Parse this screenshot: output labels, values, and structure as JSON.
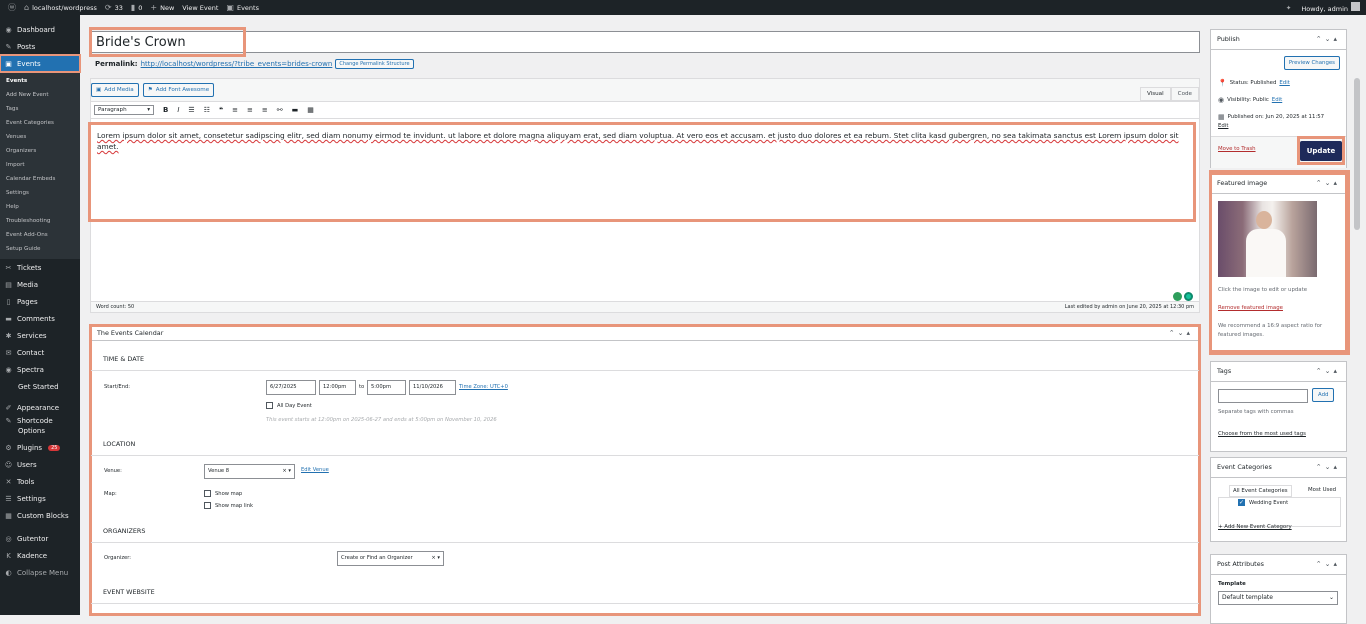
{
  "adminbar": {
    "site": "localhost/wordpress",
    "updates": "33",
    "comments": "0",
    "new": "New",
    "view_event": "View Event",
    "events": "Events",
    "howdy": "Howdy, admin"
  },
  "sidebar": {
    "items": [
      {
        "label": "Dashboard",
        "icon": "dashboard-icon"
      },
      {
        "label": "Posts",
        "icon": "pin-icon"
      },
      {
        "label": "Events",
        "icon": "calendar-icon"
      }
    ],
    "events_sub": [
      "Events",
      "Add New Event",
      "Tags",
      "Event Categories",
      "Venues",
      "Organizers",
      "Import",
      "Calendar Embeds",
      "Settings",
      "Help",
      "Troubleshooting",
      "Event Add-Ons",
      "Setup Guide"
    ],
    "items2": [
      {
        "label": "Tickets"
      },
      {
        "label": "Media"
      },
      {
        "label": "Pages"
      },
      {
        "label": "Comments"
      },
      {
        "label": "Services"
      },
      {
        "label": "Contact"
      },
      {
        "label": "Spectra"
      },
      {
        "label": "Get Started"
      },
      {
        "label": "Appearance"
      },
      {
        "label": "Shortcode"
      },
      {
        "label": "Options"
      },
      {
        "label": "Plugins",
        "badge": "25"
      },
      {
        "label": "Users"
      },
      {
        "label": "Tools"
      },
      {
        "label": "Settings"
      },
      {
        "label": "Custom Blocks"
      },
      {
        "label": "Gutentor"
      },
      {
        "label": "Kadence"
      },
      {
        "label": "Collapse Menu"
      }
    ]
  },
  "post": {
    "title": "Bride's Crown",
    "permalink_label": "Permalink:",
    "permalink": "http://localhost/wordpress/?tribe_events=brides-crown",
    "change_permalink": "Change Permalink Structure"
  },
  "editor": {
    "add_media": "Add Media",
    "add_fa": "Add Font Awesome",
    "tab_visual": "Visual",
    "tab_code": "Code",
    "format": "Paragraph",
    "content": "Lorem ipsum dolor sit amet, consetetur sadipscing elitr, sed diam nonumy eirmod te invidunt. ut labore et dolore magna aliquyam erat, sed diam voluptua. At vero eos et accusam. et justo duo dolores et ea rebum. Stet clita kasd gubergren, no sea takimata sanctus est Lorem ipsum dolor sit amet.",
    "word_count": "Word count: 50",
    "last_edited": "Last edited by admin on June 20, 2025 at 12:30 pm"
  },
  "tec": {
    "title": "The Events Calendar",
    "time_date": "TIME & DATE",
    "start_end": "Start/End:",
    "start_date": "6/27/2025",
    "start_time": "12:00pm",
    "to": "to",
    "end_time": "5:00pm",
    "end_date": "11/10/2026",
    "timezone": "Time Zone: UTC+0",
    "all_day": "All Day Event",
    "note": "This event starts at 12:00pm on 2025-06-27 and ends at 5:00pm on November 10, 2026",
    "location": "LOCATION",
    "venue_label": "Venue:",
    "venue": "Venue 8",
    "edit_venue": "Edit Venue",
    "map_label": "Map:",
    "show_map": "Show map",
    "show_map_link": "Show map link",
    "organizers": "ORGANIZERS",
    "organizer_label": "Organizer:",
    "organizer_ph": "Create or Find an Organizer",
    "website": "EVENT WEBSITE"
  },
  "publish": {
    "title": "Publish",
    "preview": "Preview Changes",
    "status": "Status: Published",
    "visibility": "Visibility: Public",
    "published_on": "Published on: Jun 20, 2025 at 11:57",
    "edit": "Edit",
    "trash": "Move to Trash",
    "update": "Update"
  },
  "featured": {
    "title": "Featured image",
    "click": "Click the image to edit or update",
    "remove": "Remove featured image",
    "recommend": "We recommend a 16:9 aspect ratio for featured images."
  },
  "tags": {
    "title": "Tags",
    "add": "Add",
    "help": "Separate tags with commas",
    "choose": "Choose from the most used tags"
  },
  "categories": {
    "title": "Event Categories",
    "tab_all": "All Event Categories",
    "tab_most": "Most Used",
    "item": "Wedding Event",
    "add_new": "+ Add New Event Category"
  },
  "attributes": {
    "title": "Post Attributes",
    "template_label": "Template",
    "template": "Default template"
  },
  "colors": {
    "accent": "#2271b1",
    "highlight": "#e8957a",
    "dark": "#1d2327"
  }
}
